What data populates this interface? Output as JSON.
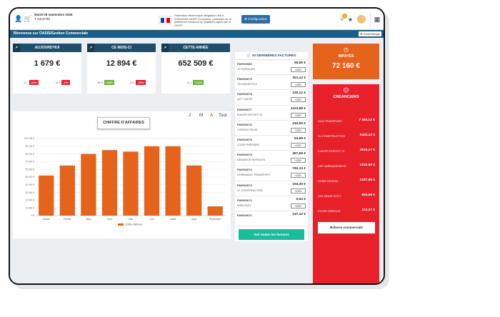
{
  "header": {
    "date_line1": "Mardi 08 septembre 2026",
    "date_line2": "T 2(6)4798",
    "federation_text": "Fédération électronique obligatoire dès le 01/09/2026 OASIS Commerce, partenaire de la plateforme Sessions by Qualisens agrée par la DGFIP",
    "config_label": "Configuration",
    "notif_count": "5"
  },
  "welcome": {
    "text": "Bienvenue sur OASIS/Gestion Commerciale",
    "param_label": "Paramétrage"
  },
  "kpis": [
    {
      "title": "AUJOURD'HUI",
      "value": "1 679 €",
      "cmp": [
        {
          "label": "J-7",
          "pct": "-13%",
          "color": "#e8202a"
        },
        {
          "label": "N-1",
          "pct": "-2%",
          "color": "#e8202a"
        }
      ]
    },
    {
      "title": "CE MOIS-CI",
      "value": "12 894 €",
      "cmp": [
        {
          "label": "M-1",
          "pct": "+40%",
          "color": "#6bb33a"
        },
        {
          "label": "N-1",
          "pct": "-29%",
          "color": "#e8202a"
        }
      ]
    },
    {
      "title": "CETTE ANNÉE",
      "value": "652 509 €",
      "cmp": [
        {
          "label": "A-1",
          "pct": "+12%",
          "color": "#6bb33a"
        }
      ]
    }
  ],
  "chart_panel": {
    "button_label": "CHIFFRE D'AFFAIRES",
    "periods": [
      "J",
      "M",
      "A",
      "Tout"
    ],
    "active_period": "A"
  },
  "chart_data": {
    "type": "bar",
    "categories": [
      "Janvier",
      "Février",
      "Mars",
      "Avril",
      "Mai",
      "Juin",
      "Juillet",
      "Août",
      "Septembre"
    ],
    "values": [
      52000,
      65000,
      80000,
      85000,
      83000,
      90000,
      90000,
      65000,
      12000
    ],
    "ylim": [
      0,
      100000
    ],
    "yticks": [
      "0 €",
      "10 000 €",
      "20 000 €",
      "30 000 €",
      "40 000 €",
      "50 000 €",
      "60 000 €",
      "70 000 €",
      "80 000 €",
      "90 000 €",
      "100 000 €"
    ],
    "legend": "Chiffre d'affaires",
    "legend_position": "bottom",
    "bar_color": "#e6631c",
    "grid": true
  },
  "invoices": {
    "title": "20 DERNIÈRES FACTURES",
    "view_label": "VOIR",
    "all_label": "Voir toutes les factures",
    "rows": [
      {
        "num": "FA0002680",
        "client": "JG SERVICES",
        "amount": "65,65 €"
      },
      {
        "num": "FA0002679",
        "client": "TECHNOSTYLE",
        "amount": "321,12 €"
      },
      {
        "num": "FA0002678",
        "client": "ACT OUEST",
        "amount": "120,12 €"
      },
      {
        "num": "FA0002677",
        "client": "EUROP EXPORT 78",
        "amount": "1123,88 €"
      },
      {
        "num": "FA0002676",
        "client": "CHRONO PAGE",
        "amount": "210,95 €"
      },
      {
        "num": "FA0002675",
        "client": "LOGIS PREMIUM",
        "amount": "64,99 €"
      },
      {
        "num": "FA0002675",
        "client": "DEMAROK SERVICES",
        "amount": "457,69 €"
      },
      {
        "num": "FA0002674",
        "client": "NORMANDY TRANSPORT",
        "amount": "782,10 €"
      },
      {
        "num": "FA0002673",
        "client": "XL CONSTRUCTION",
        "amount": "104,30 €"
      },
      {
        "num": "FA0002672",
        "client": "WEB EASY",
        "amount": "9,54 €"
      },
      {
        "num": "FA0002671",
        "client": "",
        "amount": "147,12 €"
      }
    ]
  },
  "impayes": {
    "label": "IMPAYÉS",
    "amount": "72 160 €"
  },
  "creanciers": {
    "label": "CRÉANCIERS",
    "rows": [
      {
        "name": "HLM TRANSPORT",
        "value": "7 584,12 €"
      },
      {
        "name": "XL CONSTRUCTION",
        "value": "5432,32 €"
      },
      {
        "name": "EUROP EXPORT 78",
        "value": "3819,17 €"
      },
      {
        "name": "KSP AMÉNAGEMENT",
        "value": "2215,99 €"
      },
      {
        "name": "HOME DESIGN",
        "value": "2187,99 €"
      },
      {
        "name": "DIO SENSITIVITY",
        "value": "854,56 €"
      },
      {
        "name": "EXTAR SERVICE",
        "value": "214,37 €"
      }
    ],
    "balance_label": "Balance commerciale"
  }
}
